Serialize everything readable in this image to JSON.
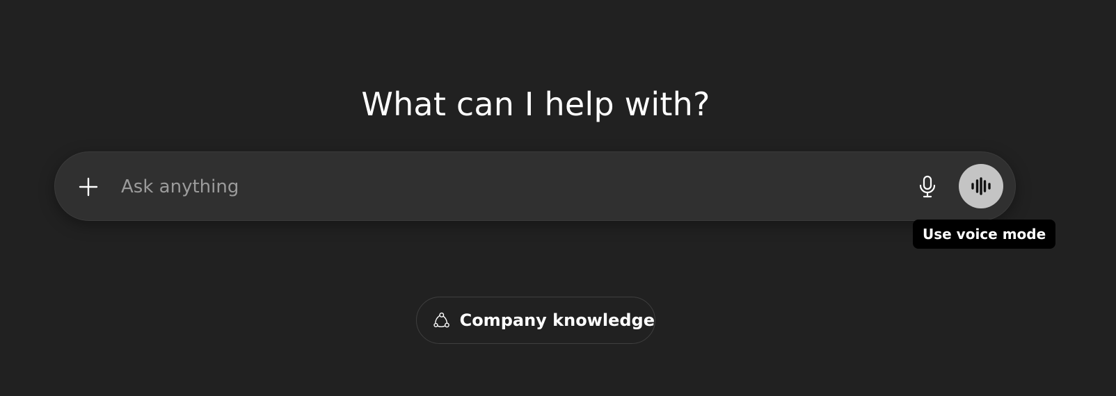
{
  "main": {
    "heading": "What can I help with?"
  },
  "composer": {
    "placeholder": "Ask anything",
    "value": "",
    "attach_icon": "plus-icon",
    "dictate_icon": "microphone-icon",
    "voice_icon": "voice-waveform-icon"
  },
  "tooltip": {
    "text": "Use voice mode"
  },
  "suggestions": [
    {
      "label": "Company knowledge",
      "icon": "connectors-icon"
    }
  ],
  "colors": {
    "background": "#212121",
    "composer": "#303030",
    "voice_button": "#c4c4c4",
    "tooltip": "#000000"
  }
}
